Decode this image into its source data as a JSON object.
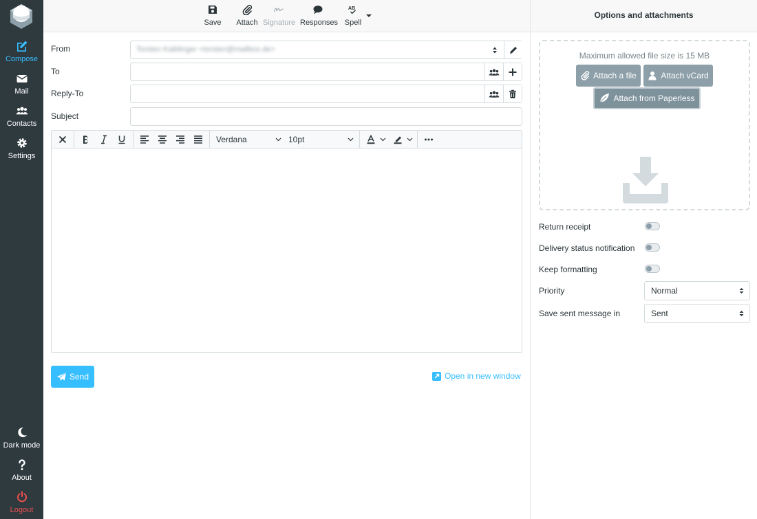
{
  "nav": {
    "items": [
      {
        "label": "Compose",
        "icon": "compose-icon"
      },
      {
        "label": "Mail",
        "icon": "mail-icon"
      },
      {
        "label": "Contacts",
        "icon": "contacts-icon"
      },
      {
        "label": "Settings",
        "icon": "gear-icon"
      }
    ],
    "bottom": [
      {
        "label": "Dark mode",
        "icon": "moon-icon"
      },
      {
        "label": "About",
        "icon": "question-icon"
      },
      {
        "label": "Logout",
        "icon": "power-icon"
      }
    ]
  },
  "toolbar": {
    "save": "Save",
    "attach": "Attach",
    "signature": "Signature",
    "responses": "Responses",
    "spell": "Spell"
  },
  "form": {
    "from_label": "From",
    "from_value": "Torsten Kaiblinger <torsten@mailbox.de>",
    "to_label": "To",
    "replyto_label": "Reply-To",
    "subject_label": "Subject"
  },
  "editor": {
    "font": "Verdana",
    "size": "10pt"
  },
  "actions": {
    "send": "Send",
    "open_new_window": "Open in new window"
  },
  "side": {
    "title": "Options and attachments",
    "max_size": "Maximum allowed file size is 15 MB",
    "attach_file": "Attach a file",
    "attach_vcard": "Attach vCard",
    "attach_paperless": "Attach from Paperless",
    "return_receipt": "Return receipt",
    "delivery_status": "Delivery status notification",
    "keep_formatting": "Keep formatting",
    "priority_label": "Priority",
    "priority_value": "Normal",
    "save_sent_label": "Save sent message in",
    "save_sent_value": "Sent"
  },
  "colors": {
    "accent": "#37beff",
    "nav_bg": "#2f3a3f",
    "logout": "#f04f4f",
    "attach_btn": "#8d9fa8"
  }
}
